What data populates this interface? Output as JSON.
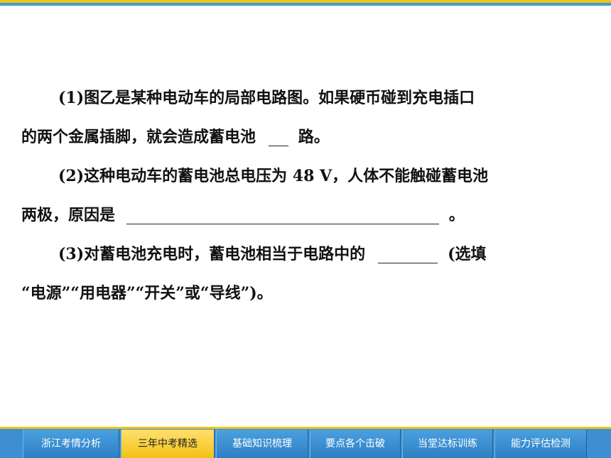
{
  "question": {
    "part1_line1": "(1)图乙是某种电动车的局部电路图。如果硬币碰到充电插口",
    "part1_line2_before": "的两个金属插脚，就会造成蓄电池",
    "part1_line2_after": "路。",
    "part2_line1": "(2)这种电动车的蓄电池总电压为 48 V，人体不能触碰蓄电池",
    "part2_line2_before": "两极，原因是",
    "part2_line2_after": "。",
    "part3_line1_before": "(3)对蓄电池充电时，蓄电池相当于电路中的",
    "part3_line1_after": "(选填",
    "part3_line2": "“电源”“用电器”“开关”或“导线”)。"
  },
  "nav": {
    "tabs": [
      {
        "label": "浙江考情分析"
      },
      {
        "label": "三年中考精选"
      },
      {
        "label": "基础知识梳理"
      },
      {
        "label": "要点各个击破"
      },
      {
        "label": "当堂达标训练"
      },
      {
        "label": "能力评估检测"
      }
    ],
    "active_index": 1
  },
  "colors": {
    "accent_yellow": "#f3c316",
    "accent_blue": "#3d8fd1"
  }
}
